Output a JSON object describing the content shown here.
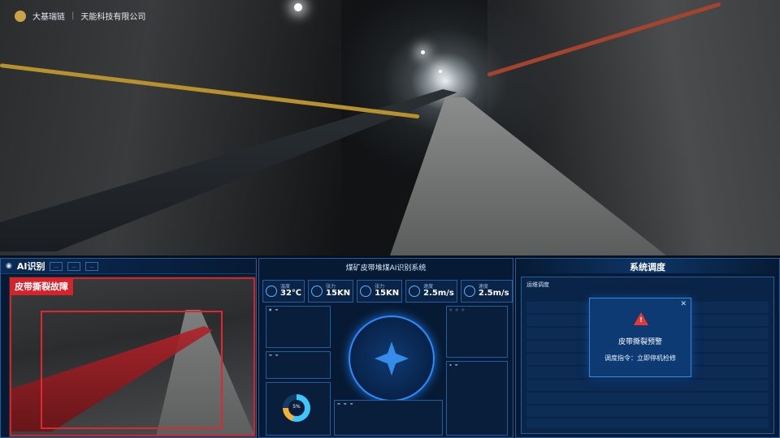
{
  "brand": {
    "name": "大基瑞链",
    "company": "天能科技有限公司"
  },
  "left_panel": {
    "title": "AI识别",
    "tabs": [
      "...",
      "...",
      "..."
    ],
    "alarm_label": "皮带撕裂故障"
  },
  "mid_panel": {
    "title": "煤矿皮带堆煤AI识别系统",
    "metrics": [
      {
        "label": "温度",
        "value": "32℃",
        "icon": "thermometer-icon"
      },
      {
        "label": "张力",
        "value": "15KN",
        "icon": "gauge-icon"
      },
      {
        "label": "张力",
        "value": "15KN",
        "icon": "gauge-icon"
      },
      {
        "label": "速度",
        "value": "2.5m/s",
        "icon": "speed-icon"
      },
      {
        "label": "速度",
        "value": "2.5m/s",
        "icon": "speed-icon"
      }
    ],
    "donut_value": "5%"
  },
  "right_panel": {
    "title": "系统调度",
    "section": "运维调度",
    "alert": {
      "title": "皮带撕裂预警",
      "instruction": "调度指令：立即停机检修",
      "close": "✕",
      "icon": "warning-icon"
    }
  }
}
